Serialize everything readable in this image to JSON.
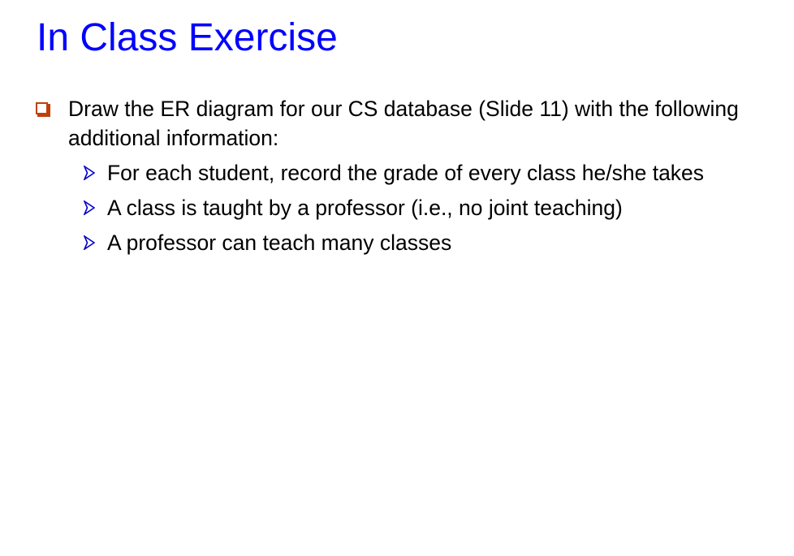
{
  "slide": {
    "title": "In Class Exercise",
    "bullets": [
      {
        "text": "Draw the ER diagram for our CS database (Slide 11) with the following additional information:",
        "icon": "square-bullet-icon",
        "sub_bullets": [
          {
            "text": "For each student, record the grade of every class he/she takes",
            "icon": "arrow-bullet-icon"
          },
          {
            "text": "A class is taught by a professor (i.e., no joint teaching)",
            "icon": "arrow-bullet-icon"
          },
          {
            "text": "A professor can teach many classes",
            "icon": "arrow-bullet-icon"
          }
        ]
      }
    ]
  },
  "colors": {
    "title": "#0000ff",
    "square_bullet": "#c0400a",
    "arrow_bullet": "#0000cc",
    "text": "#000000",
    "background": "#ffffff"
  }
}
